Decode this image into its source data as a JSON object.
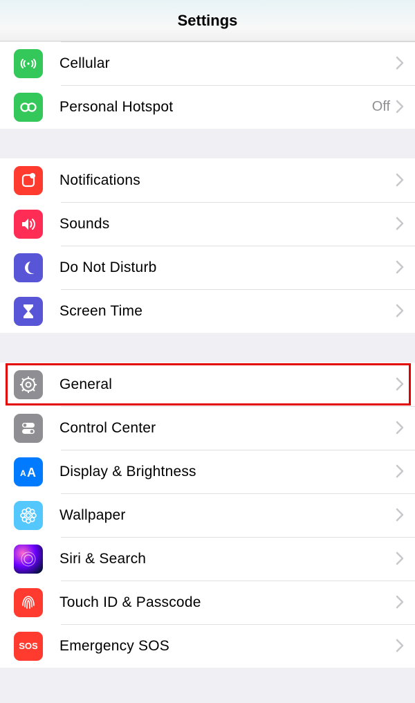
{
  "header": {
    "title": "Settings"
  },
  "groups": [
    {
      "items": [
        {
          "id": "cellular",
          "label": "Cellular",
          "value": ""
        },
        {
          "id": "hotspot",
          "label": "Personal Hotspot",
          "value": "Off"
        }
      ]
    },
    {
      "items": [
        {
          "id": "notifications",
          "label": "Notifications",
          "value": ""
        },
        {
          "id": "sounds",
          "label": "Sounds",
          "value": ""
        },
        {
          "id": "dnd",
          "label": "Do Not Disturb",
          "value": ""
        },
        {
          "id": "screentime",
          "label": "Screen Time",
          "value": ""
        }
      ]
    },
    {
      "items": [
        {
          "id": "general",
          "label": "General",
          "value": "",
          "highlighted": true
        },
        {
          "id": "control",
          "label": "Control Center",
          "value": ""
        },
        {
          "id": "display",
          "label": "Display & Brightness",
          "value": ""
        },
        {
          "id": "wallpaper",
          "label": "Wallpaper",
          "value": ""
        },
        {
          "id": "siri",
          "label": "Siri & Search",
          "value": ""
        },
        {
          "id": "touchid",
          "label": "Touch ID & Passcode",
          "value": ""
        },
        {
          "id": "sos",
          "label": "Emergency SOS",
          "value": ""
        }
      ]
    }
  ]
}
